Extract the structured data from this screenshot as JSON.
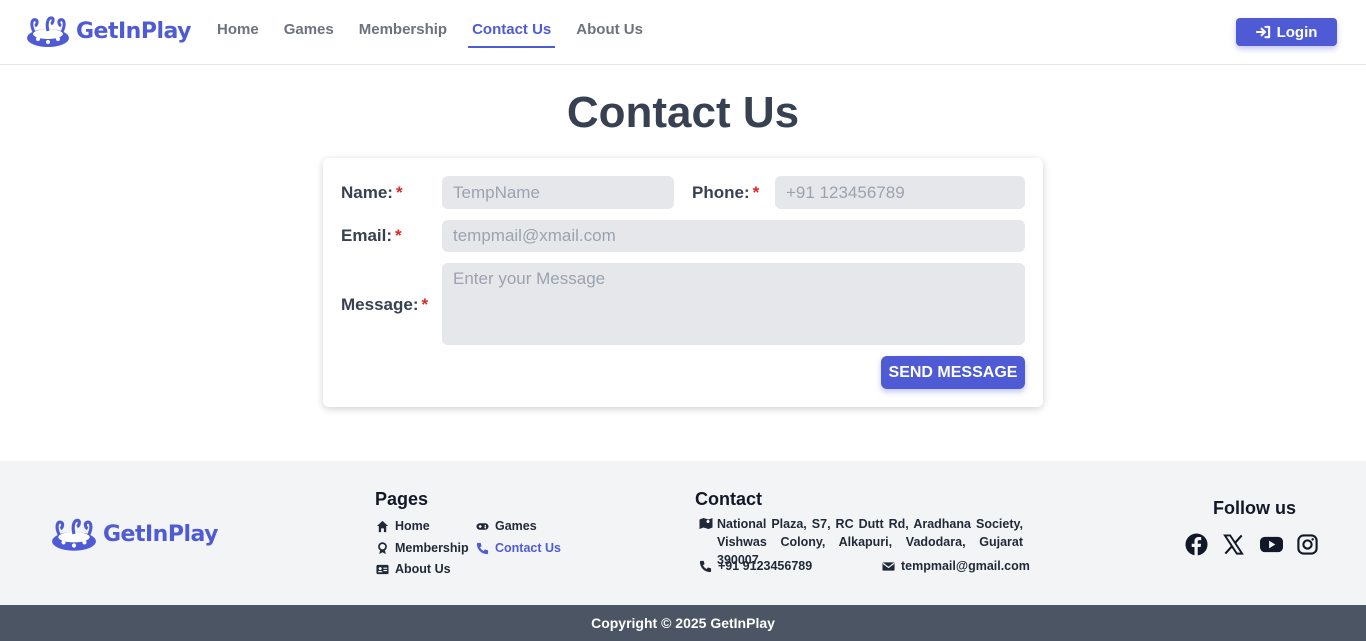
{
  "brand": {
    "name": "GetInPlay",
    "accent": "#4f5bd5"
  },
  "nav": {
    "items": [
      {
        "label": "Home",
        "active": false
      },
      {
        "label": "Games",
        "active": false
      },
      {
        "label": "Membership",
        "active": false
      },
      {
        "label": "Contact Us",
        "active": true
      },
      {
        "label": "About Us",
        "active": false
      }
    ],
    "login_label": "Login"
  },
  "page": {
    "title": "Contact Us"
  },
  "form": {
    "name_label": "Name:",
    "name_placeholder": "TempName",
    "phone_label": "Phone:",
    "phone_placeholder": "+91 123456789",
    "email_label": "Email:",
    "email_placeholder": "tempmail@xmail.com",
    "message_label": "Message:",
    "message_placeholder": "Enter your Message",
    "required_mark": "*",
    "send_label": "SEND MESSAGE"
  },
  "footer": {
    "pages_heading": "Pages",
    "pages": [
      {
        "label": "Home",
        "icon": "home-icon"
      },
      {
        "label": "Games",
        "icon": "gamepad-icon"
      },
      {
        "label": "Membership",
        "icon": "award-icon"
      },
      {
        "label": "Contact Us",
        "icon": "phone-icon",
        "active": true
      },
      {
        "label": "About Us",
        "icon": "id-card-icon"
      }
    ],
    "contact_heading": "Contact",
    "address": "National Plaza, S7, RC Dutt Rd, Aradhana Society, Vishwas Colony, Alkapuri, Vadodara, Gujarat 390007",
    "phone": "+91 9123456789",
    "email": "tempmail@gmail.com",
    "follow_heading": "Follow us",
    "social": [
      "facebook-icon",
      "x-icon",
      "youtube-icon",
      "instagram-icon"
    ],
    "copyright": "Copyright © 2025 GetInPlay"
  }
}
